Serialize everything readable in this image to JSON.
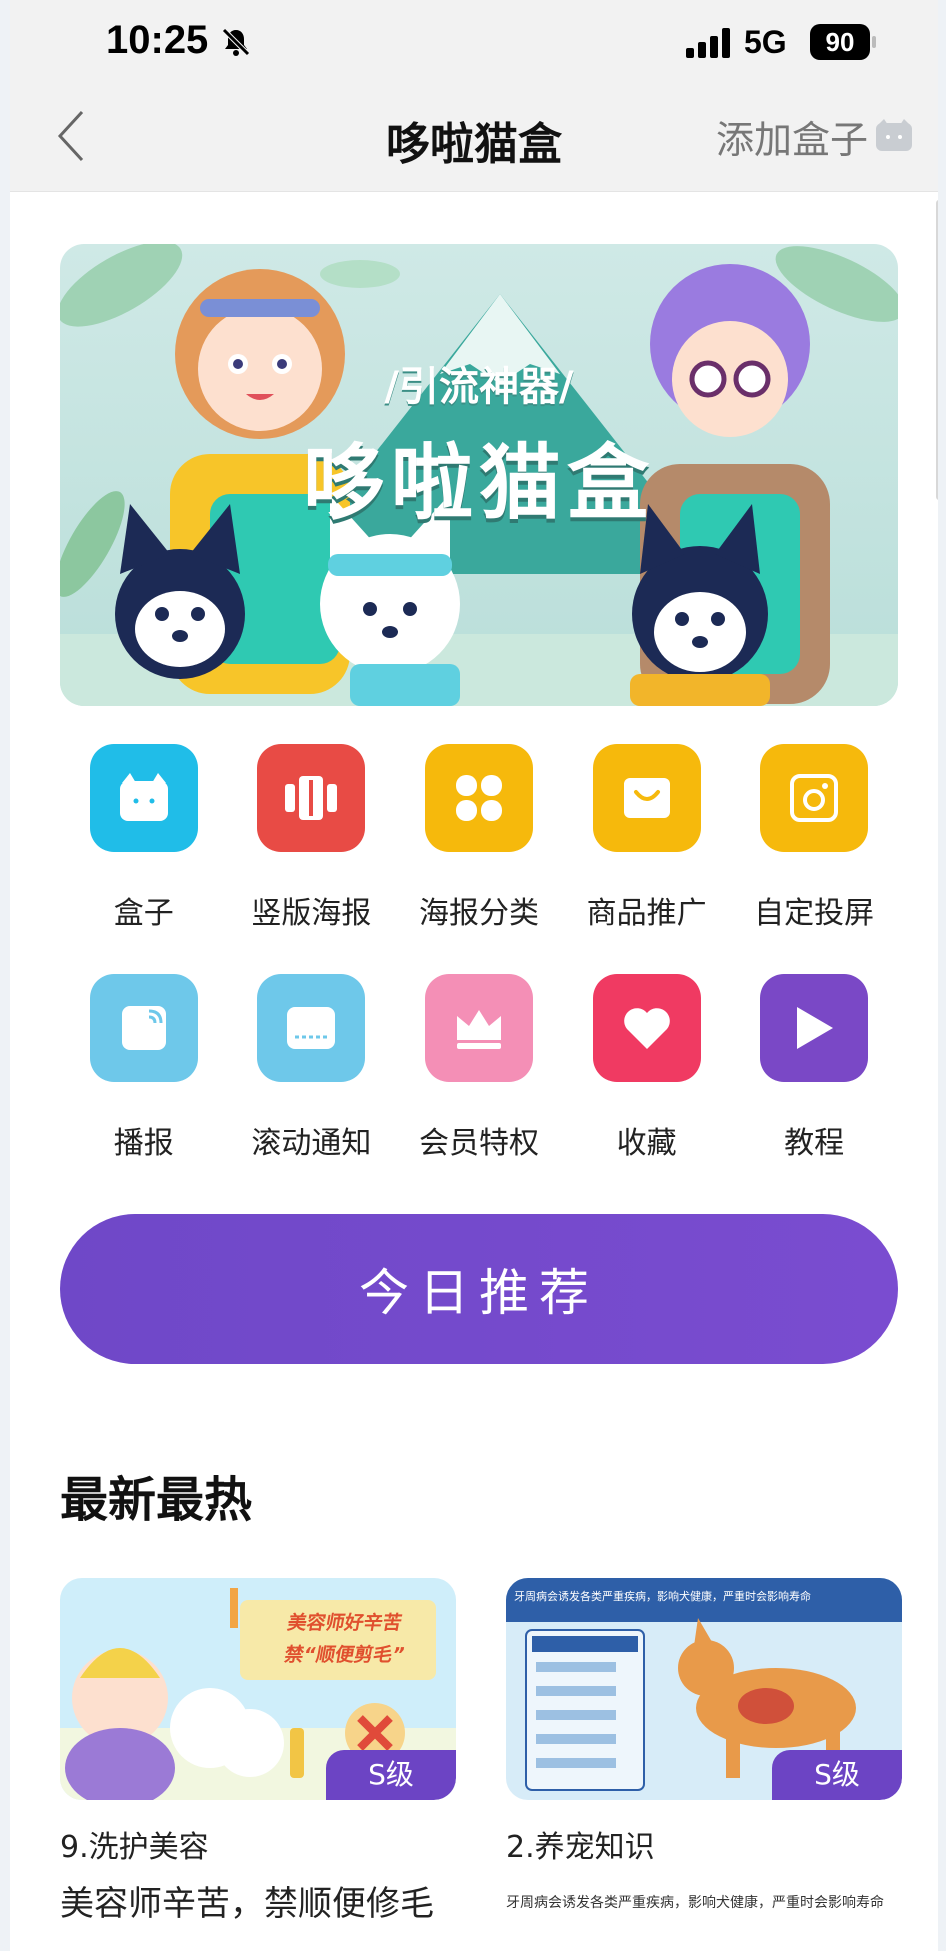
{
  "status_bar": {
    "time": "10:25",
    "network": "5G",
    "battery": "90"
  },
  "nav": {
    "title": "哆啦猫盒",
    "add_box_label": "添加盒子"
  },
  "banner": {
    "slogan": "/引流神器/",
    "title": "哆啦猫盒"
  },
  "grid": [
    {
      "label": "盒子",
      "icon": "box-icon",
      "color": "#20bde8"
    },
    {
      "label": "竖版海报",
      "icon": "vertical-poster-icon",
      "color": "#e84b45"
    },
    {
      "label": "海报分类",
      "icon": "poster-category-icon",
      "color": "#f6b90c"
    },
    {
      "label": "商品推广",
      "icon": "product-promo-icon",
      "color": "#f6b90c"
    },
    {
      "label": "自定投屏",
      "icon": "screen-cast-icon",
      "color": "#f6b90c"
    },
    {
      "label": "播报",
      "icon": "broadcast-icon",
      "color": "#6ec8ea"
    },
    {
      "label": "滚动通知",
      "icon": "scroll-notice-icon",
      "color": "#6ec8ea"
    },
    {
      "label": "会员特权",
      "icon": "crown-icon",
      "color": "#f48fb6"
    },
    {
      "label": "收藏",
      "icon": "heart-icon",
      "color": "#f03a62"
    },
    {
      "label": "教程",
      "icon": "play-icon",
      "color": "#7a48c6"
    }
  ],
  "recommend_label": "今日推荐",
  "section_title": "最新最热",
  "cards": [
    {
      "thumb_caption": "美容师好辛苦",
      "thumb_caption2": "禁“顺便剪毛”",
      "grade": "S级",
      "category": "9.洗护美容",
      "description": "美容师辛苦，禁顺便修毛"
    },
    {
      "thumb_caption": "牙周病会诱发各类严重疾病，影响犬健康，严重时会影响寿命",
      "grade": "S级",
      "category": "2.养宠知识",
      "description": "牙周病会诱发各类严重疾病，影响犬健康，严重时会影响寿命"
    }
  ]
}
